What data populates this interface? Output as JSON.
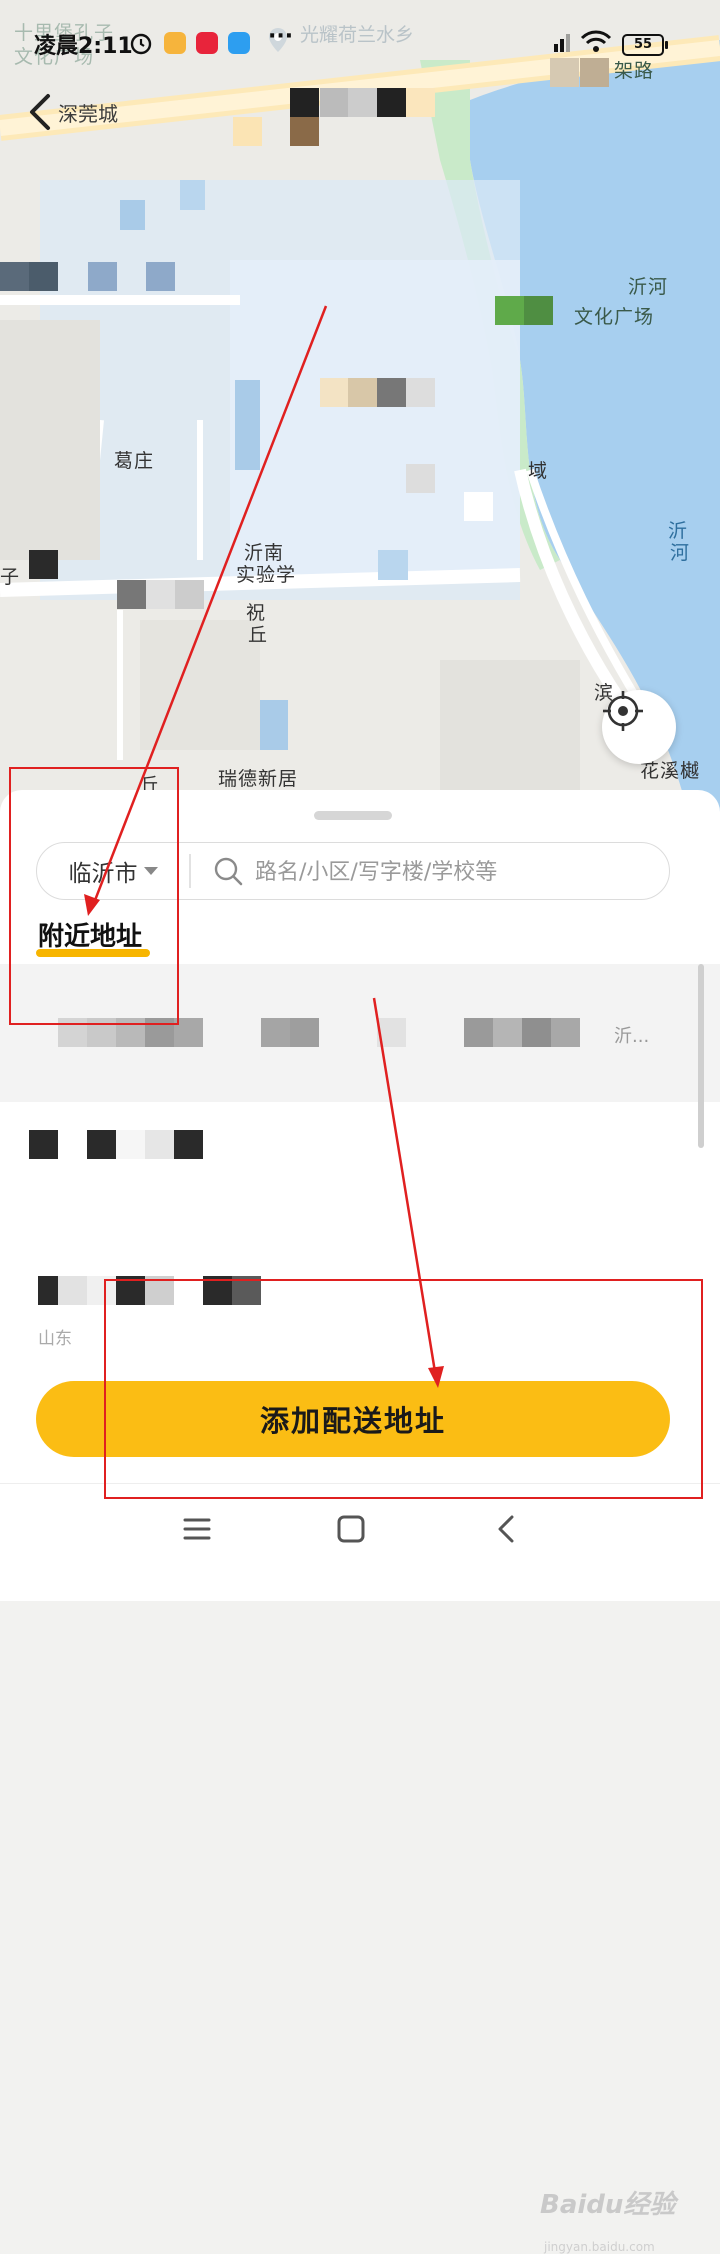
{
  "status_bar": {
    "time": "凌晨2:11",
    "battery": "55",
    "map_overlay_text": "光耀荷兰水乡",
    "more_dots": "···"
  },
  "header": {
    "back_label": "深莞城"
  },
  "map": {
    "labels": {
      "top_left_1": "十里堡孔子",
      "top_left_2": "文化广场",
      "top_right": "架路",
      "river_1": "沂河",
      "culture_square": "文化广场",
      "river_2_a": "沂",
      "river_2_b": "河",
      "ge": "葛庄",
      "field": "域",
      "school_1": "沂南",
      "school_2": "实验学",
      "zi": "子",
      "zhu": "祝",
      "qiu": "丘",
      "ruide": "瑞德新居",
      "huaxi": "花溪樾",
      "bin": "滨",
      "qiu2": "丘"
    },
    "colors": {
      "river": "#a7cfef",
      "park": "#c9eac9",
      "road": "#ffffff",
      "land": "#ecebe7"
    }
  },
  "sheet": {
    "city": "临沂市",
    "search_placeholder": "路名/小区/写字楼/学校等",
    "nearby_title": "附近地址",
    "rows": [
      {
        "suffix": "沂..."
      },
      {
        "suffix": ""
      },
      {
        "sub": "山东"
      }
    ],
    "add_button_label": "添加配送地址"
  },
  "nav": {
    "menu_icon": "menu-icon",
    "home_icon": "home-icon",
    "back_icon": "back-icon"
  },
  "watermark": {
    "text": "Baidu经验",
    "sub": "jingyan.baidu.com"
  },
  "accent_colors": {
    "button": "#fbbd14",
    "underline": "#f7b500",
    "annotation": "#e02020"
  }
}
